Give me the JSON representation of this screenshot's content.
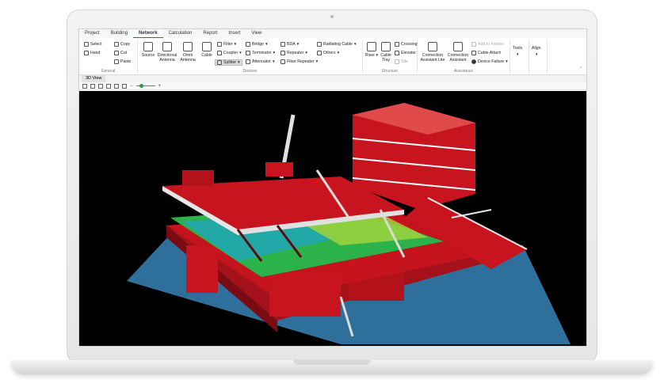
{
  "menu": {
    "tabs": [
      "Project",
      "Building",
      "Network",
      "Calculation",
      "Report",
      "Insert",
      "View"
    ],
    "active_tab": "Network"
  },
  "ribbon": {
    "general": {
      "label": "General",
      "select": "Select",
      "hand": "Hand",
      "copy": "Copy",
      "cut": "Cut",
      "paste": "Paste"
    },
    "devices": {
      "label": "Devices",
      "source": "Source",
      "directional_antenna_1": "Directional",
      "directional_antenna_2": "Antenna",
      "omni_antenna_1": "Omni",
      "omni_antenna_2": "Antenna",
      "cable": "Cable",
      "filter": "Filter",
      "coupler": "Coupler",
      "splitter": "Splitter",
      "bridge": "Bridge",
      "terminator": "Terminator",
      "attenuator": "Attenuator",
      "bda": "BDA",
      "repeater": "Repeater",
      "fiber_repeater": "Fiber Repeater",
      "radiating_cable": "Radiating Cable",
      "others": "Others"
    },
    "structure": {
      "label": "Structure",
      "riser": "Riser",
      "cable_tray_1": "Cable",
      "cable_tray_2": "Tray",
      "crossing": "Crossing",
      "elevator": "Elevator",
      "site": "Site"
    },
    "assistance": {
      "label": "Assistance",
      "connection_lite_1": "Connection",
      "connection_lite_2": "Assistant Lite",
      "connection_1": "Connection",
      "connection_2": "Assistant",
      "add_to_feeder": "Add to Feeder",
      "cable_attach": "Cable Attach",
      "device_failure": "Device Failure"
    },
    "tools": "Tools",
    "align": "Align"
  },
  "view_tab": "3D View",
  "colors": {
    "accent": "#2a7d3b",
    "structure": "#c8141e",
    "water": "#2f6f9c",
    "viewport_bg": "#000000"
  }
}
